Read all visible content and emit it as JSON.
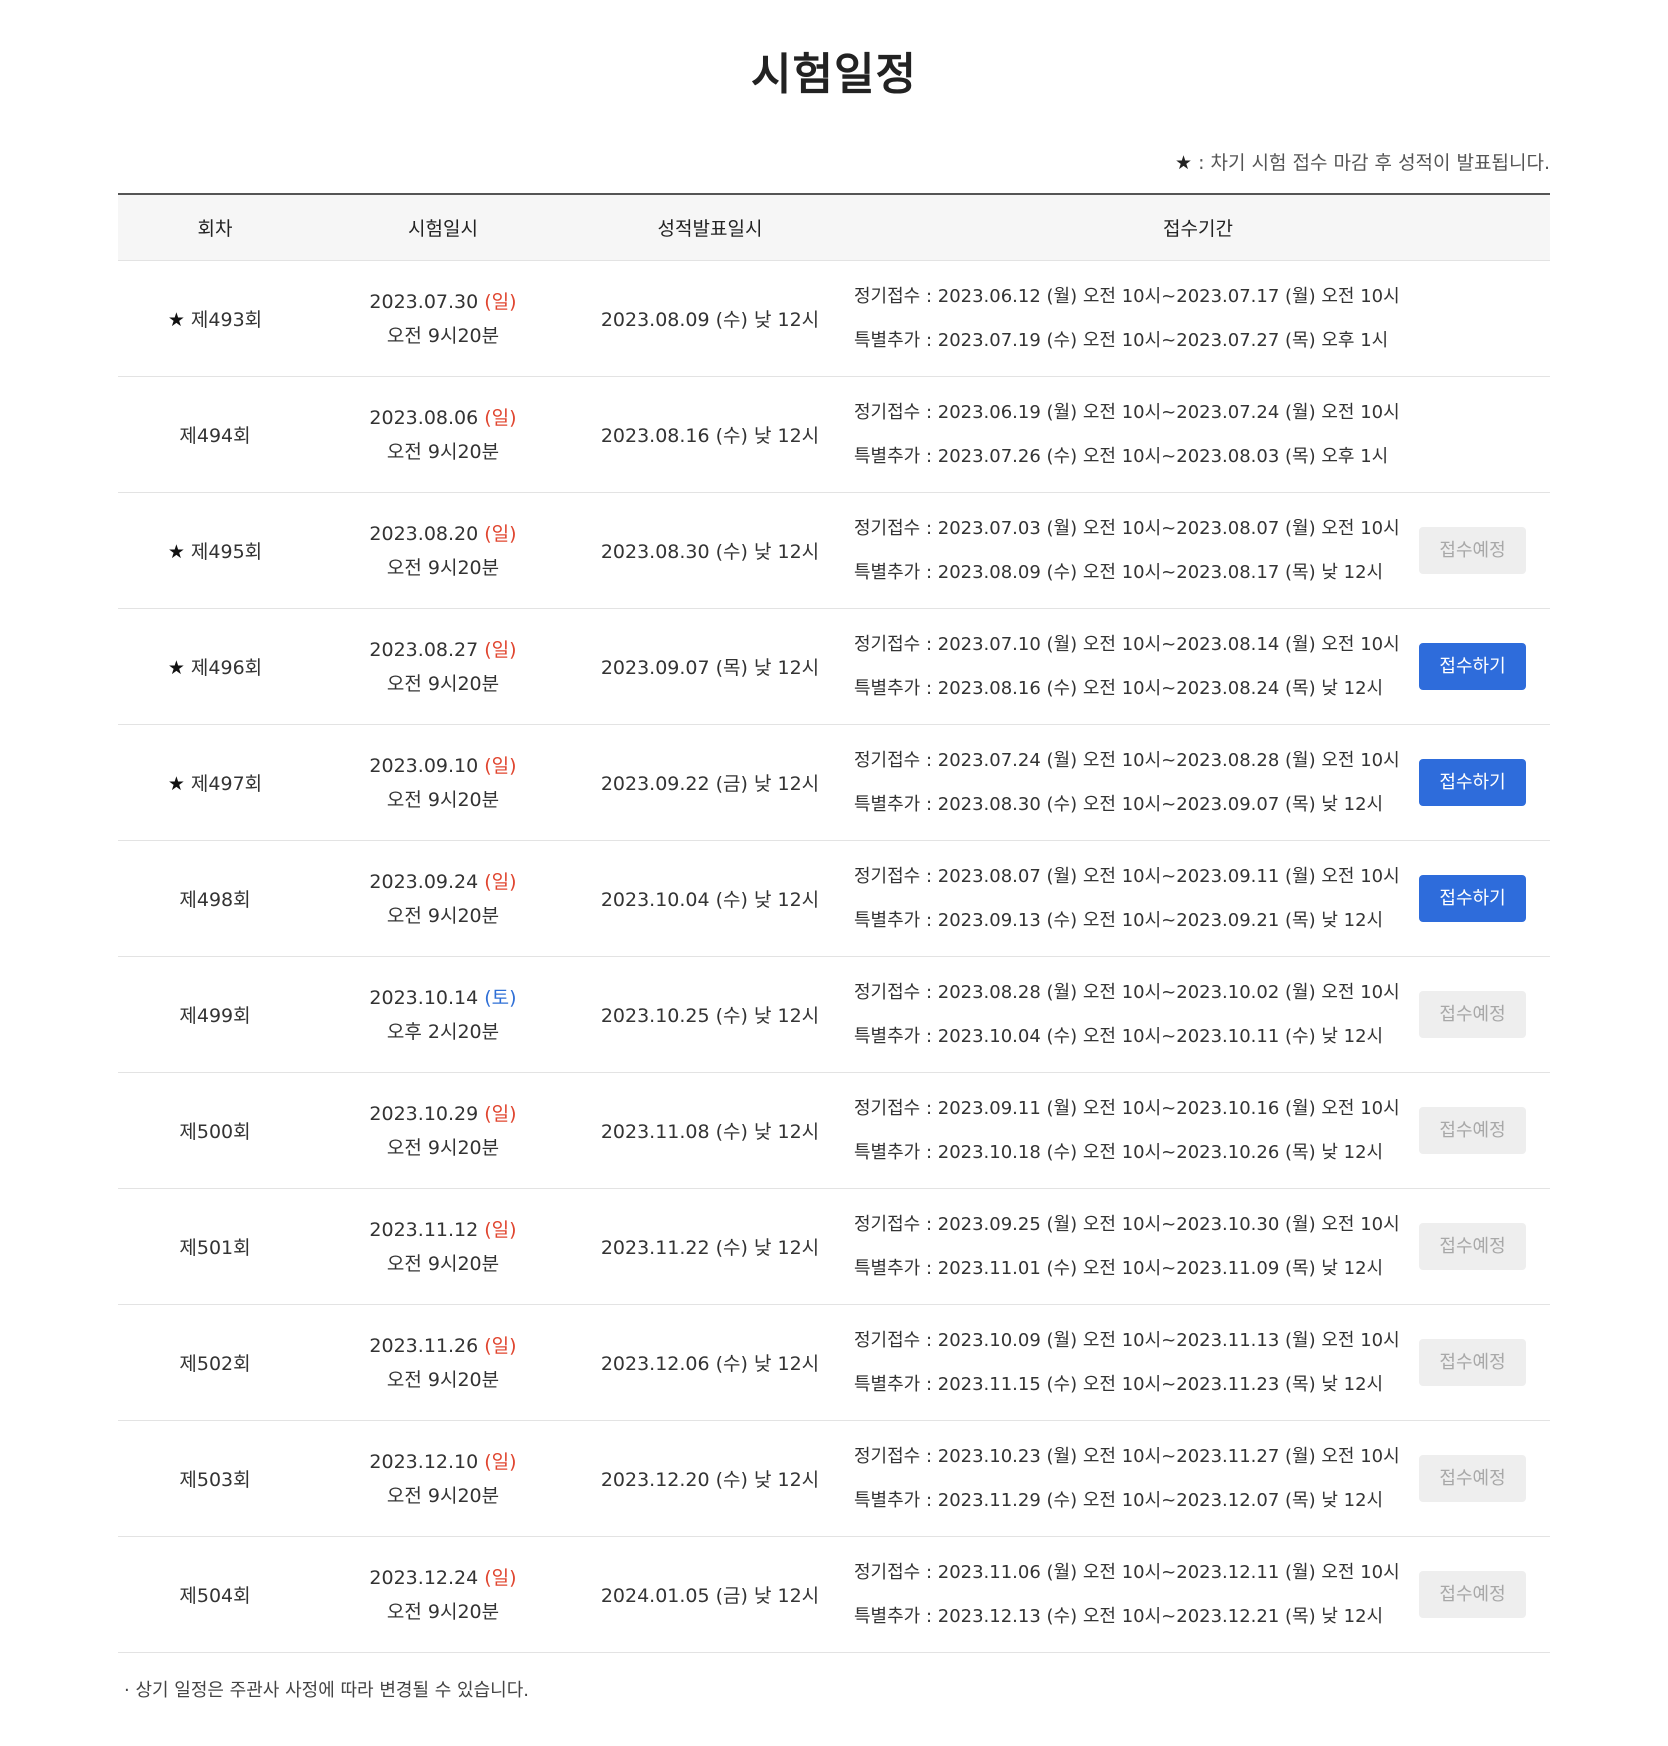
{
  "page_title": "시험일정",
  "legend_note": {
    "star": "★",
    "text": " : 차기 시험 접수 마감 후 성적이 발표됩니다."
  },
  "table": {
    "headers": [
      "회차",
      "시험일시",
      "성적발표일시",
      "접수기간",
      ""
    ],
    "rows": [
      {
        "star": "★",
        "round": "제493회",
        "exam_date": "2023.07.30",
        "exam_day": "(일)",
        "exam_day_type": "sun",
        "exam_time": "오전 9시20분",
        "result": "2023.08.09 (수) 낮 12시",
        "regular": "정기접수 : 2023.06.12 (월) 오전 10시~2023.07.17 (월) 오전 10시",
        "special": "특별추가 : 2023.07.19 (수) 오전 10시~2023.07.27 (목) 오후 1시",
        "button": null,
        "button_state": "none"
      },
      {
        "star": "",
        "round": "제494회",
        "exam_date": "2023.08.06",
        "exam_day": "(일)",
        "exam_day_type": "sun",
        "exam_time": "오전 9시20분",
        "result": "2023.08.16 (수) 낮 12시",
        "regular": "정기접수 : 2023.06.19 (월) 오전 10시~2023.07.24 (월) 오전 10시",
        "special": "특별추가 : 2023.07.26 (수) 오전 10시~2023.08.03 (목) 오후 1시",
        "button": null,
        "button_state": "none"
      },
      {
        "star": "★",
        "round": "제495회",
        "exam_date": "2023.08.20",
        "exam_day": "(일)",
        "exam_day_type": "sun",
        "exam_time": "오전 9시20분",
        "result": "2023.08.30 (수) 낮 12시",
        "regular": "정기접수 : 2023.07.03 (월) 오전 10시~2023.08.07 (월) 오전 10시",
        "special": "특별추가 : 2023.08.09 (수) 오전 10시~2023.08.17 (목) 낮 12시",
        "button": "접수예정",
        "button_state": "pending"
      },
      {
        "star": "★",
        "round": "제496회",
        "exam_date": "2023.08.27",
        "exam_day": "(일)",
        "exam_day_type": "sun",
        "exam_time": "오전 9시20분",
        "result": "2023.09.07 (목) 낮 12시",
        "regular": "정기접수 : 2023.07.10 (월) 오전 10시~2023.08.14 (월) 오전 10시",
        "special": "특별추가 : 2023.08.16 (수) 오전 10시~2023.08.24 (목) 낮 12시",
        "button": "접수하기",
        "button_state": "active"
      },
      {
        "star": "★",
        "round": "제497회",
        "exam_date": "2023.09.10",
        "exam_day": "(일)",
        "exam_day_type": "sun",
        "exam_time": "오전 9시20분",
        "result": "2023.09.22 (금) 낮 12시",
        "regular": "정기접수 : 2023.07.24 (월) 오전 10시~2023.08.28 (월) 오전 10시",
        "special": "특별추가 : 2023.08.30 (수) 오전 10시~2023.09.07 (목) 낮 12시",
        "button": "접수하기",
        "button_state": "active"
      },
      {
        "star": "",
        "round": "제498회",
        "exam_date": "2023.09.24",
        "exam_day": "(일)",
        "exam_day_type": "sun",
        "exam_time": "오전 9시20분",
        "result": "2023.10.04 (수) 낮 12시",
        "regular": "정기접수 : 2023.08.07 (월) 오전 10시~2023.09.11 (월) 오전 10시",
        "special": "특별추가 : 2023.09.13 (수) 오전 10시~2023.09.21 (목) 낮 12시",
        "button": "접수하기",
        "button_state": "active"
      },
      {
        "star": "",
        "round": "제499회",
        "exam_date": "2023.10.14",
        "exam_day": "(토)",
        "exam_day_type": "sat",
        "exam_time": "오후 2시20분",
        "result": "2023.10.25 (수) 낮 12시",
        "regular": "정기접수 : 2023.08.28 (월) 오전 10시~2023.10.02 (월) 오전 10시",
        "special": "특별추가 : 2023.10.04 (수) 오전 10시~2023.10.11 (수) 낮 12시",
        "button": "접수예정",
        "button_state": "pending"
      },
      {
        "star": "",
        "round": "제500회",
        "exam_date": "2023.10.29",
        "exam_day": "(일)",
        "exam_day_type": "sun",
        "exam_time": "오전 9시20분",
        "result": "2023.11.08 (수) 낮 12시",
        "regular": "정기접수 : 2023.09.11 (월) 오전 10시~2023.10.16 (월) 오전 10시",
        "special": "특별추가 : 2023.10.18 (수) 오전 10시~2023.10.26 (목) 낮 12시",
        "button": "접수예정",
        "button_state": "pending"
      },
      {
        "star": "",
        "round": "제501회",
        "exam_date": "2023.11.12",
        "exam_day": "(일)",
        "exam_day_type": "sun",
        "exam_time": "오전 9시20분",
        "result": "2023.11.22 (수) 낮 12시",
        "regular": "정기접수 : 2023.09.25 (월) 오전 10시~2023.10.30 (월) 오전 10시",
        "special": "특별추가 : 2023.11.01 (수) 오전 10시~2023.11.09 (목) 낮 12시",
        "button": "접수예정",
        "button_state": "pending"
      },
      {
        "star": "",
        "round": "제502회",
        "exam_date": "2023.11.26",
        "exam_day": "(일)",
        "exam_day_type": "sun",
        "exam_time": "오전 9시20분",
        "result": "2023.12.06 (수) 낮 12시",
        "regular": "정기접수 : 2023.10.09 (월) 오전 10시~2023.11.13 (월) 오전 10시",
        "special": "특별추가 : 2023.11.15 (수) 오전 10시~2023.11.23 (목) 낮 12시",
        "button": "접수예정",
        "button_state": "pending"
      },
      {
        "star": "",
        "round": "제503회",
        "exam_date": "2023.12.10",
        "exam_day": "(일)",
        "exam_day_type": "sun",
        "exam_time": "오전 9시20분",
        "result": "2023.12.20 (수) 낮 12시",
        "regular": "정기접수 : 2023.10.23 (월) 오전 10시~2023.11.27 (월) 오전 10시",
        "special": "특별추가 : 2023.11.29 (수) 오전 10시~2023.12.07 (목) 낮 12시",
        "button": "접수예정",
        "button_state": "pending"
      },
      {
        "star": "",
        "round": "제504회",
        "exam_date": "2023.12.24",
        "exam_day": "(일)",
        "exam_day_type": "sun",
        "exam_time": "오전 9시20분",
        "result": "2024.01.05 (금) 낮 12시",
        "regular": "정기접수 : 2023.11.06 (월) 오전 10시~2023.12.11 (월) 오전 10시",
        "special": "특별추가 : 2023.12.13 (수) 오전 10시~2023.12.21 (목) 낮 12시",
        "button": "접수예정",
        "button_state": "pending"
      }
    ]
  },
  "footer_note": "· 상기 일정은 주관사 사정에 따라 변경될 수 있습니다.",
  "colors": {
    "sunday": "#e0452f",
    "saturday": "#2f6fd6",
    "button_active": "#2e6cdb",
    "button_pending": "#eeeeee"
  }
}
